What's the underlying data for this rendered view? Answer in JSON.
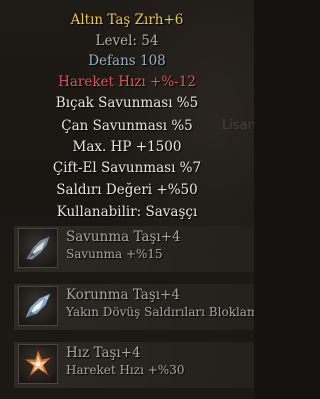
{
  "item": {
    "title": "Altın Taş Zırh+6",
    "level": "Level: 54",
    "defense": "Defans 108",
    "penalty": "Hareket Hızı +%-12",
    "bonuses": [
      "Bıçak Savunması %5",
      "Çan Savunması %5",
      "Max. HP +1500",
      "Çift-El Savunması %7",
      "Saldırı Değeri +%50"
    ],
    "usable": "Kullanabilir:  Savaşçı",
    "background_text": "Lisans"
  },
  "stones": [
    {
      "name": "Savunma Taşı+4",
      "effect": "Savunma +%15",
      "icon": "defense-stone-icon"
    },
    {
      "name": "Korunma Taşı+4",
      "effect": "Yakın Dövüş Saldırıları Bloklama",
      "icon": "protection-stone-icon"
    },
    {
      "name": "Hız Taşı+4",
      "effect": "Hareket Hızı +%30",
      "icon": "speed-stone-icon"
    }
  ],
  "colors": {
    "title": "#f0c93b",
    "defense": "#97b1bf",
    "penalty": "#e15456",
    "bonus": "#e9e6e0",
    "stat": "#b3aea6"
  }
}
